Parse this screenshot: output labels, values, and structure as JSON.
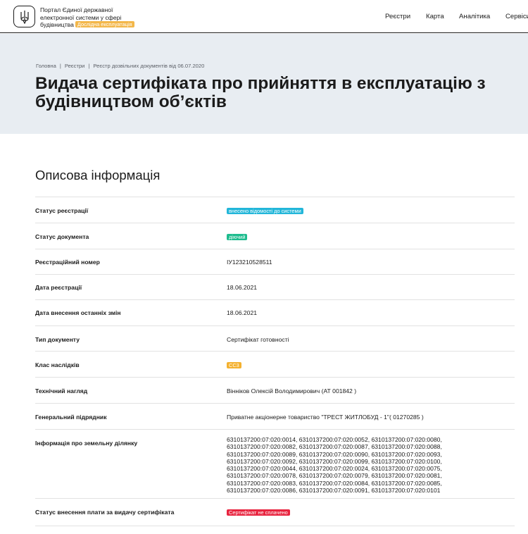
{
  "header": {
    "brand_line1": "Портал Єдиної державної",
    "brand_line2": "електронної системи у сфері",
    "brand_line3": "будівництва",
    "beta_badge": "Дослідна експлуатація",
    "nav": [
      "Реєстри",
      "Карта",
      "Аналітика",
      "Сервіси"
    ]
  },
  "breadcrumb": [
    "Головна",
    "Реєстри",
    "Реєстр дозвільних документів від 06.07.2020"
  ],
  "page_title_line1": "Видача сертифіката про прийняття в експлуатацію з",
  "page_title_line2": "будівництвом об’єктів",
  "section_title": "Описова інформація",
  "colors": {
    "cyan": "#22b6d9",
    "green": "#1ebc8e",
    "yellow": "#f4b12f",
    "red": "#e8243f",
    "beta": "#f3b74a"
  },
  "rows": [
    {
      "label": "Статус реєстрації",
      "tag": "внесено відомості до системи",
      "color": "cyan"
    },
    {
      "label": "Статус документа",
      "tag": "діючий",
      "color": "green"
    },
    {
      "label": "Реєстраційний номер",
      "value": "ІУ123210528511"
    },
    {
      "label": "Дата реєстрації",
      "value": "18.06.2021"
    },
    {
      "label": "Дата внесення останніх змін",
      "value": "18.06.2021"
    },
    {
      "label": "Тип документу",
      "value": "Сертифікат готовності"
    },
    {
      "label": "Клас наслідків",
      "tag": "СС3",
      "color": "yellow"
    },
    {
      "label": "Технічний нагляд",
      "value": "Вінніков Олексій Володимирович (АТ 001842 )"
    },
    {
      "label": "Генеральний підрядник",
      "value": "Приватне акціонерне товариство \"ТРЕСТ ЖИТЛОБУД - 1\"( 01270285 )"
    },
    {
      "label": "Інформація про земельну ділянку",
      "lines": [
        "6310137200:07:020:0014, 6310137200:07:020:0052, 6310137200:07:020:0080,",
        "6310137200:07:020:0082, 6310137200:07:020:0087, 6310137200:07:020:0088,",
        "6310137200:07:020:0089, 6310137200:07:020:0090, 6310137200:07:020:0093,",
        "6310137200:07:020:0092, 6310137200:07:020:0099, 6310137200:07:020:0100,",
        "6310137200:07:020:0044, 6310137200:07:020:0024, 6310137200:07:020:0075,",
        "6310137200:07:020:0078, 6310137200:07:020:0079, 6310137200:07:020:0081,",
        "6310137200:07:020:0083, 6310137200:07:020:0084, 6310137200:07:020:0085,",
        "6310137200:07:020:0086, 6310137200:07:020:0091, 6310137200:07:020:0101"
      ]
    },
    {
      "label": "Статус внесення плати за видачу сертифіката",
      "tag": "Сертифікат не сплачено",
      "color": "red"
    }
  ]
}
